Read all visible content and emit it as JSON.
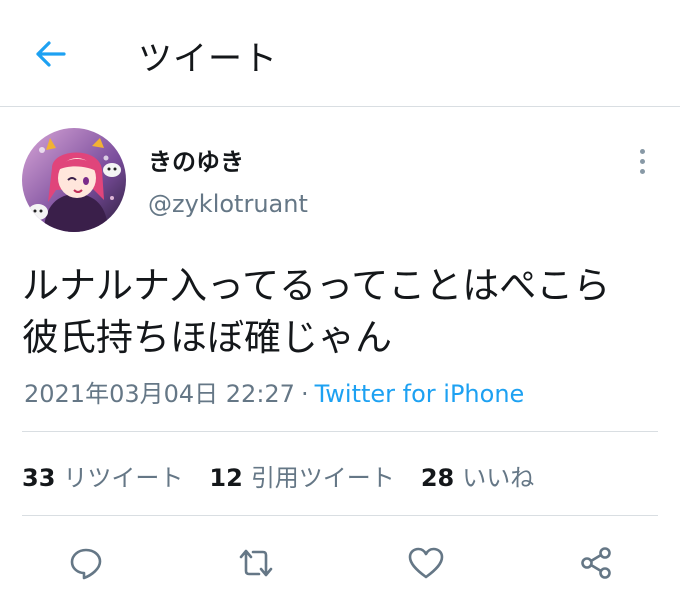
{
  "header": {
    "title": "ツイート",
    "back_icon": "arrow-left-icon",
    "accent_color": "#1da1f2"
  },
  "tweet": {
    "author": {
      "display_name": "きのゆき",
      "handle": "@zyklotruant"
    },
    "text_lines": [
      "ルナルナ入ってるってことはぺこら",
      "彼氏持ちほぼ確じゃん"
    ],
    "timestamp": "2021年03月04日 22:27",
    "separator": "·",
    "source": "Twitter for iPhone",
    "stats": {
      "retweets": {
        "count": "33",
        "label": "リツイート"
      },
      "quotes": {
        "count": "12",
        "label": "引用ツイート"
      },
      "likes": {
        "count": "28",
        "label": "いいね"
      }
    }
  },
  "actions": {
    "reply_icon": "reply-icon",
    "retweet_icon": "retweet-icon",
    "like_icon": "heart-icon",
    "share_icon": "share-icon"
  }
}
